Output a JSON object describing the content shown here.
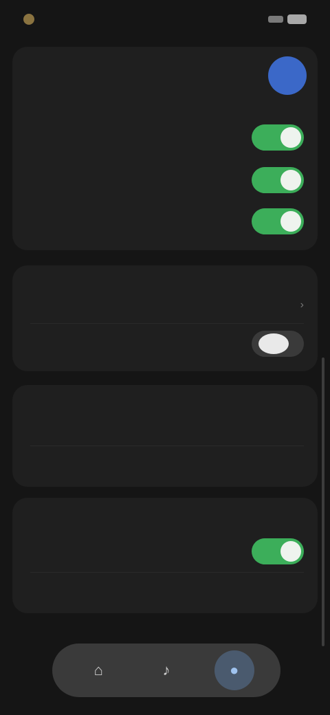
{
  "status": {
    "time": "",
    "icons": [
      "signal-icon",
      "battery-icon"
    ]
  },
  "header": {
    "title": "",
    "avatar_letter": "",
    "subtitle": ""
  },
  "top_settings": [
    {
      "label": "",
      "state": "on"
    },
    {
      "label": "",
      "state": "on"
    },
    {
      "label": "",
      "state": "on"
    }
  ],
  "section_b": {
    "label": "",
    "rows": [
      {
        "label": "",
        "value": ""
      },
      {
        "label": "",
        "state": "off"
      }
    ]
  },
  "section_c": {
    "label": "",
    "rows": [
      {
        "label": "",
        "value": ""
      },
      {
        "label": "",
        "value": ""
      }
    ]
  },
  "section_d": {
    "label": "",
    "rows": [
      {
        "label": "",
        "state": "on"
      },
      {
        "label": "",
        "value": ""
      }
    ]
  },
  "dock": {
    "items": [
      "home-icon",
      "bell-icon",
      "user-icon"
    ],
    "active_index": 2
  },
  "colors": {
    "background": "#151515",
    "card": "#1f1f1f",
    "toggle_on": "#3cae5a",
    "avatar": "#3b68c8"
  }
}
